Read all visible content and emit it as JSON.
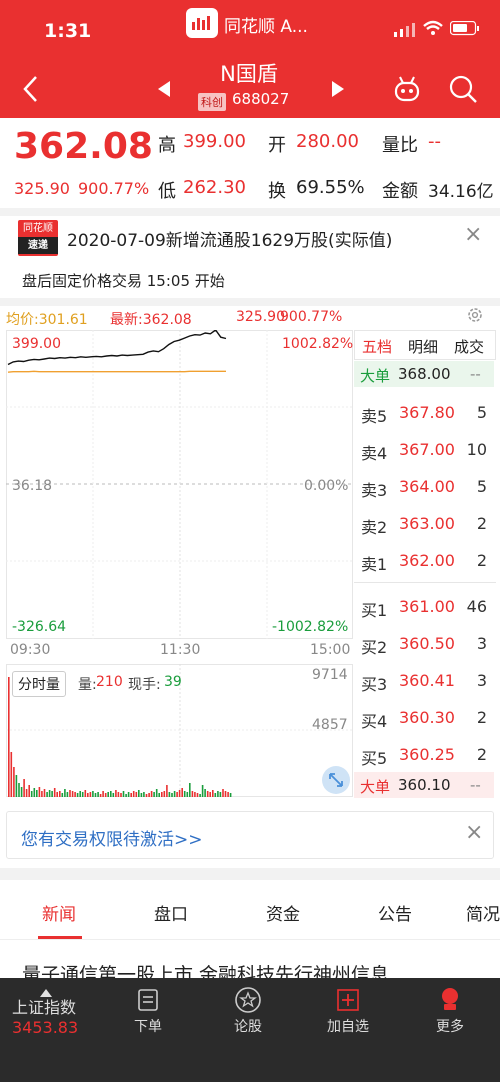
{
  "status": {
    "time": "1:31",
    "app_title": "同花顺 A..."
  },
  "nav": {
    "name": "N国盾",
    "board_badge": "科创",
    "code": "688027"
  },
  "quote": {
    "price": "362.08",
    "change": "325.90",
    "change_pct": "900.77%",
    "high_label": "高",
    "high": "399.00",
    "open_label": "开",
    "open": "280.00",
    "ratio_label": "量比",
    "ratio": "--",
    "low_label": "低",
    "low": "262.30",
    "turnover_label": "换",
    "turnover": "69.55%",
    "amount_label": "金额",
    "amount": "34.16亿"
  },
  "news_flash": {
    "logo_top": "同花顺",
    "logo_bottom": "速递",
    "text": "2020-07-09新增流通股1629万股(实际值)"
  },
  "after_hours": {
    "text": "盘后固定价格交易 15:05 开始"
  },
  "chart": {
    "avg_label": "均价:301.61",
    "latest_label": "最新:362.08",
    "latest_change": "325.90",
    "latest_pct": "900.77%",
    "y_top": "399.00",
    "y_top_pct": "1002.82%",
    "y_mid": "36.18",
    "y_mid_pct": "0.00%",
    "y_bottom": "-326.64",
    "y_bottom_pct": "-1002.82%",
    "time_start": "09:30",
    "time_mid": "11:30",
    "time_end": "15:00",
    "vol_tag": "分时量",
    "vol_label": "量:",
    "vol_value": "210",
    "cur_label": "现手:",
    "cur_value": "39",
    "vol_max": "9714",
    "vol_mid": "4857",
    "colors": {
      "price": "#111111",
      "avg": "#f0a030",
      "up": "#e93030",
      "down": "#1a9d3c"
    }
  },
  "chart_data": {
    "type": "line",
    "title": "",
    "series": [
      {
        "values": [
          318,
          324,
          326,
          325,
          328,
          330,
          329,
          331,
          333,
          332,
          334,
          333,
          335,
          334,
          336,
          335,
          336,
          337,
          336,
          338,
          339,
          338,
          340,
          339,
          340,
          341,
          342,
          347,
          350,
          348,
          355,
          365,
          372,
          375,
          380,
          385,
          388,
          387,
          392,
          390,
          399,
          382,
          379
        ]
      },
      {
        "values": [
          300,
          301,
          301,
          301,
          301,
          302,
          301,
          301,
          301,
          301,
          301,
          301,
          301,
          301,
          301,
          301,
          301,
          301,
          301,
          301,
          301,
          301,
          301,
          301,
          301,
          301,
          301,
          301,
          301,
          301,
          301,
          301,
          301,
          301,
          301,
          302,
          302,
          302,
          302,
          302,
          302,
          302,
          302
        ]
      }
    ],
    "ylim": [
      -326.64,
      399.0
    ],
    "xticks": [
      "09:30",
      "11:30",
      "15:00"
    ]
  },
  "orderbook": {
    "tabs": [
      "五档",
      "明细",
      "成交"
    ],
    "top": {
      "label": "大单",
      "price": "368.00",
      "vol": "--"
    },
    "asks": [
      {
        "label": "卖5",
        "price": "367.80",
        "vol": "5"
      },
      {
        "label": "卖4",
        "price": "367.00",
        "vol": "10"
      },
      {
        "label": "卖3",
        "price": "364.00",
        "vol": "5"
      },
      {
        "label": "卖2",
        "price": "363.00",
        "vol": "2"
      },
      {
        "label": "卖1",
        "price": "362.00",
        "vol": "2"
      }
    ],
    "bids": [
      {
        "label": "买1",
        "price": "361.00",
        "vol": "46"
      },
      {
        "label": "买2",
        "price": "360.50",
        "vol": "3"
      },
      {
        "label": "买3",
        "price": "360.41",
        "vol": "3"
      },
      {
        "label": "买4",
        "price": "360.30",
        "vol": "2"
      },
      {
        "label": "买5",
        "price": "360.25",
        "vol": "2"
      }
    ],
    "bottom": {
      "label": "大单",
      "price": "360.10",
      "vol": "--"
    }
  },
  "permission": {
    "text": "您有交易权限待激活>>"
  },
  "info_tabs": [
    "新闻",
    "盘口",
    "资金",
    "公告",
    "简况"
  ],
  "headline": "量子通信第一股上市 金融科技先行神州信息",
  "bottom_bar": {
    "index_name": "上证指数",
    "index_value": "3453.83",
    "items": [
      {
        "label": "下单",
        "icon": "order-icon"
      },
      {
        "label": "论股",
        "icon": "discuss-icon"
      },
      {
        "label": "加自选",
        "icon": "add-watchlist-icon"
      },
      {
        "label": "更多",
        "icon": "more-icon"
      }
    ]
  }
}
